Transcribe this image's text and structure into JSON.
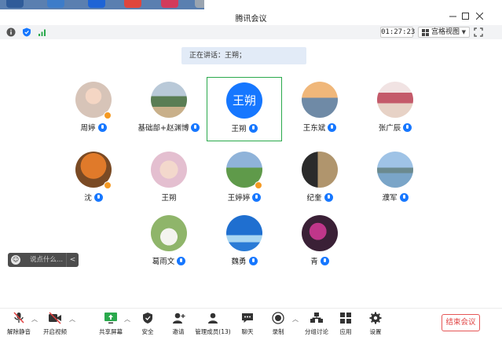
{
  "window": {
    "title": "腾讯会议"
  },
  "infobar": {
    "timer": "01:27:23",
    "view_mode": "宫格视图"
  },
  "speaking": {
    "text": "正在讲话：王朔；"
  },
  "participants": [
    {
      "name": "周婷",
      "mic": true,
      "host": true,
      "avatar": "photo-child"
    },
    {
      "name": "基础部+赵渊博",
      "mic": true,
      "avatar": "photo-runner"
    },
    {
      "name": "王朔",
      "mic": true,
      "active": true,
      "avatar_text": "王朔"
    },
    {
      "name": "王东斌",
      "mic": true,
      "avatar": "photo-seaside"
    },
    {
      "name": "张广辰",
      "mic": true,
      "avatar": "photo-group"
    },
    {
      "name": "沈",
      "mic": true,
      "host": true,
      "avatar": "photo-autumn-tree"
    },
    {
      "name": "王朔",
      "mic": false,
      "avatar": "photo-baby"
    },
    {
      "name": "王婷婷",
      "mic": true,
      "host": true,
      "avatar": "photo-meadow"
    },
    {
      "name": "纪奎",
      "mic": true,
      "avatar": "photo-calligraphy"
    },
    {
      "name": "濮军",
      "mic": true,
      "avatar": "photo-lake"
    },
    {
      "name": "葛雨文",
      "mic": true,
      "avatar": "photo-teacup"
    },
    {
      "name": "魏勇",
      "mic": true,
      "avatar": "photo-blue-sky"
    },
    {
      "name": "青",
      "mic": true,
      "avatar": "photo-flower"
    }
  ],
  "chat": {
    "placeholder": "说点什么..."
  },
  "toolbar": {
    "unmute": "解除静音",
    "start_video": "开启视频",
    "share_screen": "共享屏幕",
    "security": "安全",
    "invite": "邀请",
    "manage_members": "管理成员(13)",
    "chat": "聊天",
    "record": "录制",
    "breakout": "分组讨论",
    "apps": "应用",
    "settings": "设置",
    "end_meeting": "结束会议"
  },
  "colors": {
    "accent": "#1677ff",
    "active_border": "#2aa94c",
    "end_red": "#e04040"
  }
}
